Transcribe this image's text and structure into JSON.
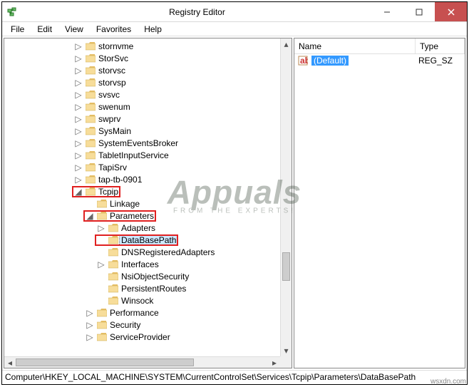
{
  "window": {
    "title": "Registry Editor"
  },
  "menu": {
    "file": "File",
    "edit": "Edit",
    "view": "View",
    "favorites": "Favorites",
    "help": "Help"
  },
  "tree": {
    "items": [
      {
        "indent": 6,
        "tw": "▷",
        "label": "stornvme"
      },
      {
        "indent": 6,
        "tw": "▷",
        "label": "StorSvc"
      },
      {
        "indent": 6,
        "tw": "▷",
        "label": "storvsc"
      },
      {
        "indent": 6,
        "tw": "▷",
        "label": "storvsp"
      },
      {
        "indent": 6,
        "tw": "▷",
        "label": "svsvc"
      },
      {
        "indent": 6,
        "tw": "▷",
        "label": "swenum"
      },
      {
        "indent": 6,
        "tw": "▷",
        "label": "swprv"
      },
      {
        "indent": 6,
        "tw": "▷",
        "label": "SysMain"
      },
      {
        "indent": 6,
        "tw": "▷",
        "label": "SystemEventsBroker"
      },
      {
        "indent": 6,
        "tw": "▷",
        "label": "TabletInputService"
      },
      {
        "indent": 6,
        "tw": "▷",
        "label": "TapiSrv"
      },
      {
        "indent": 6,
        "tw": "▷",
        "label": "tap-tb-0901"
      },
      {
        "indent": 6,
        "tw": "◢",
        "label": "Tcpip",
        "hl": true
      },
      {
        "indent": 7,
        "tw": "",
        "label": "Linkage"
      },
      {
        "indent": 7,
        "tw": "◢",
        "label": "Parameters",
        "hl": true
      },
      {
        "indent": 8,
        "tw": "▷",
        "label": "Adapters"
      },
      {
        "indent": 8,
        "tw": "",
        "label": "DataBasePath",
        "hl": true,
        "sel": true
      },
      {
        "indent": 8,
        "tw": "",
        "label": "DNSRegisteredAdapters"
      },
      {
        "indent": 8,
        "tw": "▷",
        "label": "Interfaces"
      },
      {
        "indent": 8,
        "tw": "",
        "label": "NsiObjectSecurity"
      },
      {
        "indent": 8,
        "tw": "",
        "label": "PersistentRoutes"
      },
      {
        "indent": 8,
        "tw": "",
        "label": "Winsock"
      },
      {
        "indent": 7,
        "tw": "▷",
        "label": "Performance"
      },
      {
        "indent": 7,
        "tw": "▷",
        "label": "Security"
      },
      {
        "indent": 7,
        "tw": "▷",
        "label": "ServiceProvider"
      }
    ]
  },
  "list": {
    "columns": {
      "name": "Name",
      "type": "Type"
    },
    "rows": [
      {
        "name": "(Default)",
        "type": "REG_SZ",
        "selected": true
      }
    ]
  },
  "status": {
    "path": "Computer\\HKEY_LOCAL_MACHINE\\SYSTEM\\CurrentControlSet\\Services\\Tcpip\\Parameters\\DataBasePath"
  },
  "watermark": {
    "brand": "Appuals",
    "tag": "FROM THE EXPERTS!"
  },
  "credit": "wsxdn.com"
}
